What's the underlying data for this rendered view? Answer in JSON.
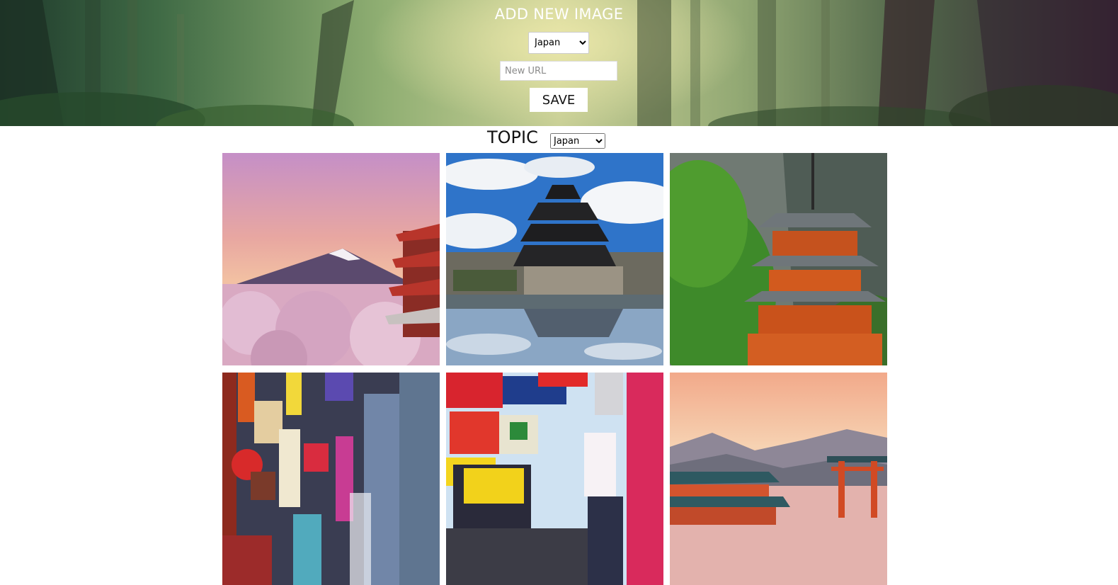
{
  "hero": {
    "title": "ADD NEW IMAGE",
    "topic_select_value": "Japan",
    "url_placeholder": "New URL",
    "save_label": "SAVE"
  },
  "topic": {
    "label": "TOPIC",
    "select_value": "Japan"
  },
  "gallery": {
    "images": [
      {
        "subject": "Mount Fuji with cherry blossoms and red pagoda"
      },
      {
        "subject": "Black castle reflected in moat"
      },
      {
        "subject": "Red pagoda in green forest"
      },
      {
        "subject": "Neon-lit Tokyo street"
      },
      {
        "subject": "Tokyo billboards and signs"
      },
      {
        "subject": "Red torii gate in the sea at sunset"
      }
    ]
  }
}
